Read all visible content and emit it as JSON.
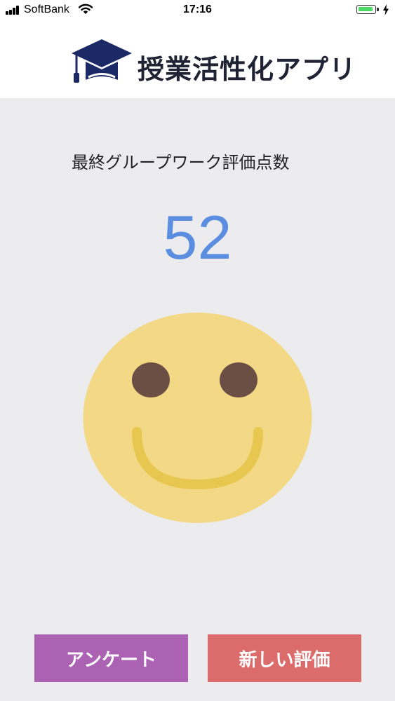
{
  "status_bar": {
    "carrier": "SoftBank",
    "time": "17:16",
    "battery_level": 0.75,
    "icons": [
      "signal-icon",
      "wifi-icon",
      "battery-icon",
      "charging-bolt-icon"
    ]
  },
  "header": {
    "logo_icon": "graduation-cap-icon",
    "title": "授業活性化アプリ"
  },
  "main": {
    "score_label": "最終グループワーク評価点数",
    "score_value": "52",
    "face_icon": "smiley-face-icon"
  },
  "actions": {
    "survey_label": "アンケート",
    "new_eval_label": "新しい評価"
  },
  "colors": {
    "background": "#ececee",
    "header_bg": "#ffffff",
    "score": "#5b8ee0",
    "face": "#f3d886",
    "face_eyes": "#6b4f45",
    "face_mouth": "#e7c74f",
    "logo": "#1b2a66",
    "survey_button": "#ab62b2",
    "new_eval_button": "#dc6c6b"
  }
}
